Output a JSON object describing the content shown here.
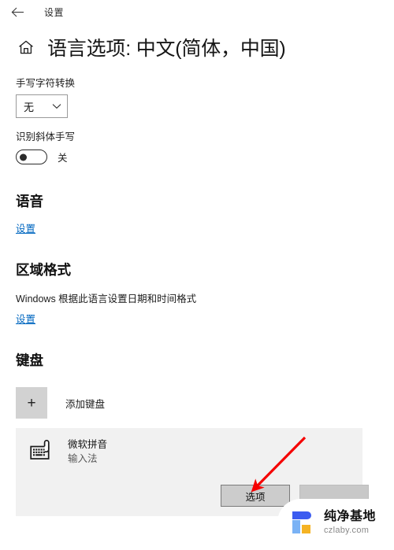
{
  "titlebar": {
    "back_icon": "back-arrow-icon",
    "title": "设置"
  },
  "header": {
    "home_icon": "home-icon",
    "title": "语言选项: 中文(简体，中国)"
  },
  "handwriting": {
    "label": "手写字符转换",
    "dropdown_value": "无",
    "chevron_icon": "chevron-down-icon"
  },
  "italic_handwriting": {
    "label": "识别斜体手写",
    "toggle_state": "关",
    "toggle_on": false
  },
  "speech": {
    "title": "语音",
    "link": "设置"
  },
  "region": {
    "title": "区域格式",
    "description": "Windows 根据此语言设置日期和时间格式",
    "link": "设置"
  },
  "keyboard": {
    "title": "键盘",
    "add_icon": "plus-icon",
    "add_label": "添加键盘",
    "item": {
      "icon": "keyboard-hand-icon",
      "name": "微软拼音",
      "subtitle": "输入法"
    },
    "options_button": "选项",
    "secondary_button": ""
  },
  "annotation": {
    "arrow_color": "#f50000",
    "arrow_icon": "red-arrow-icon"
  },
  "watermark": {
    "title": "纯净基地",
    "url": "czlaby.com",
    "logo_colors": {
      "blue_dark": "#3b5bf0",
      "blue_light": "#7ab2f5",
      "yellow": "#f5b324"
    }
  },
  "colors": {
    "link": "#0067c0",
    "card_bg": "#f1f1f1",
    "button_bg": "#cccccc"
  }
}
